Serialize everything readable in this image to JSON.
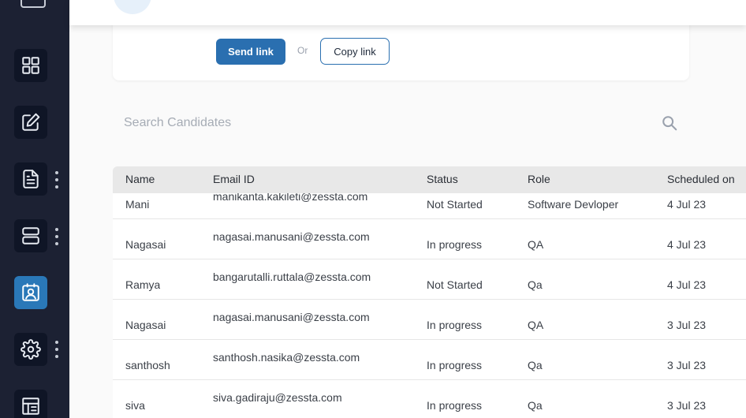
{
  "sidebar": {
    "items": [
      {
        "icon": "grid-icon"
      },
      {
        "icon": "edit-icon"
      },
      {
        "icon": "document-icon",
        "has_more": true
      },
      {
        "icon": "server-icon",
        "has_more": true
      },
      {
        "icon": "contact-card-icon",
        "active": true
      },
      {
        "icon": "gear-icon",
        "has_more": true
      },
      {
        "icon": "table-icon"
      }
    ]
  },
  "link_card": {
    "send_label": "Send link",
    "or_label": "Or",
    "copy_label": "Copy link"
  },
  "search": {
    "placeholder": "Search Candidates"
  },
  "table": {
    "headers": {
      "name": "Name",
      "email": "Email ID",
      "status": "Status",
      "role": "Role",
      "scheduled": "Scheduled on"
    },
    "rows": [
      {
        "name": "Mani",
        "email": "manikanta.kakileti@zessta.com",
        "status": "Not Started",
        "role": "Software Devloper",
        "scheduled": "4 Jul 23"
      },
      {
        "name": "Nagasai",
        "email": "nagasai.manusani@zessta.com",
        "status": "In progress",
        "role": "QA",
        "scheduled": "4 Jul 23"
      },
      {
        "name": "Ramya",
        "email": "bangarutalli.ruttala@zessta.com",
        "status": "Not Started",
        "role": "Qa",
        "scheduled": "4 Jul 23"
      },
      {
        "name": "Nagasai",
        "email": "nagasai.manusani@zessta.com",
        "status": "In progress",
        "role": "QA",
        "scheduled": "3 Jul 23"
      },
      {
        "name": "santhosh",
        "email": "santhosh.nasika@zessta.com",
        "status": "In progress",
        "role": "Qa",
        "scheduled": "3 Jul 23"
      },
      {
        "name": "siva",
        "email": "siva.gadiraju@zessta.com",
        "status": "In progress",
        "role": "Qa",
        "scheduled": "3 Jul 23"
      }
    ]
  },
  "colors": {
    "sidebar_bg": "#1c2133",
    "accent": "#2a78b8",
    "button_primary": "#2a6fb0"
  }
}
